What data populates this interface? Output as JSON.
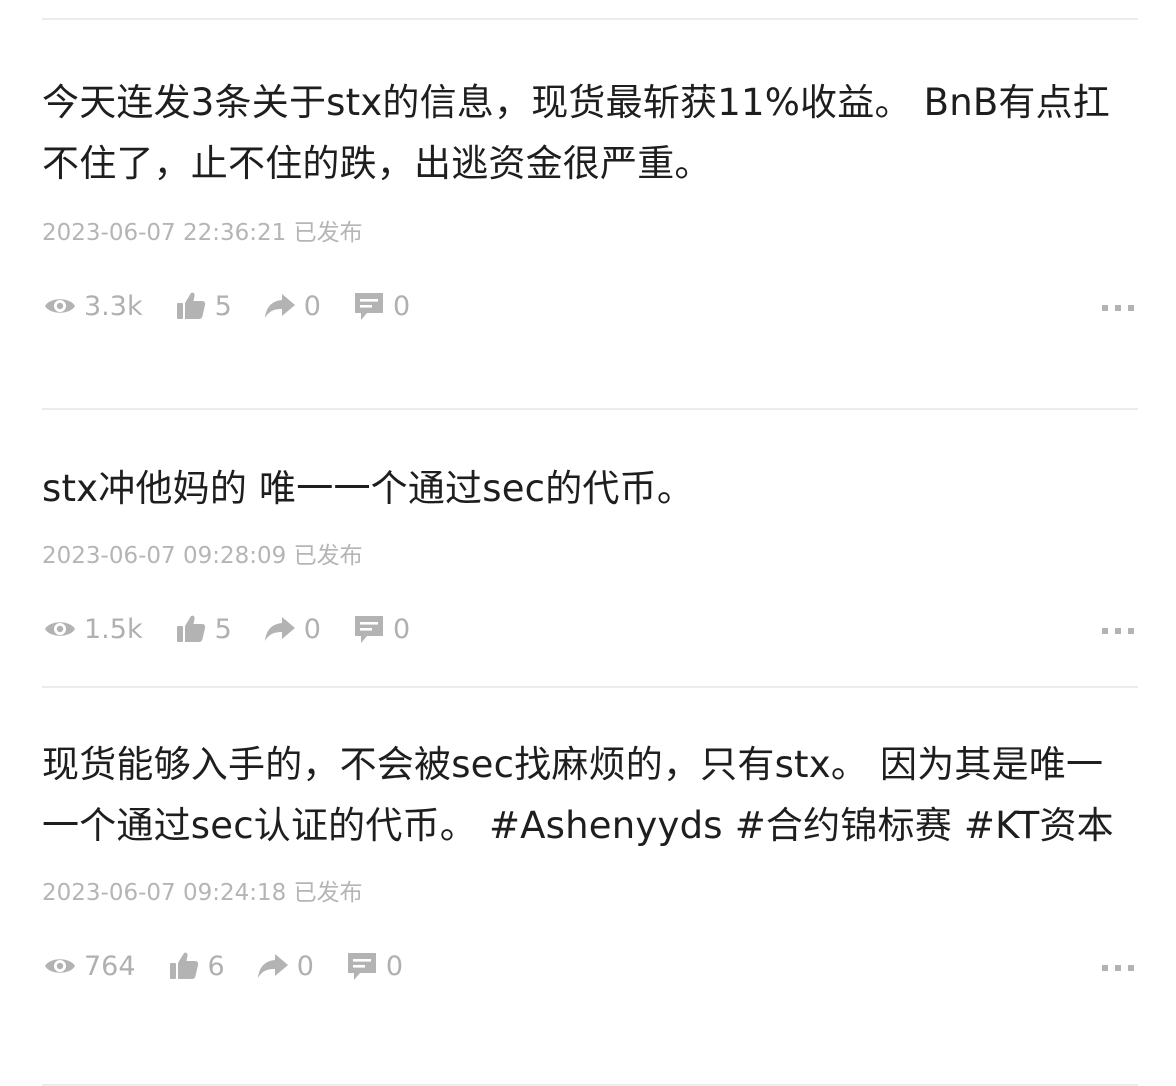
{
  "posts": [
    {
      "text": "今天连发3条关于stx的信息，现货最斩获11%收益。 BnB有点扛不住了，止不住的跌，出逃资金很严重。",
      "time": "2023-06-07 22:36:21 已发布",
      "views": "3.3k",
      "likes": "5",
      "shares": "0",
      "comments": "0"
    },
    {
      "text": "stx冲他妈的 唯一一个通过sec的代币。",
      "time": "2023-06-07 09:28:09 已发布",
      "views": "1.5k",
      "likes": "5",
      "shares": "0",
      "comments": "0"
    },
    {
      "text": "现货能够入手的，不会被sec找麻烦的，只有stx。 因为其是唯一一个通过sec认证的代币。 #Ashenyyds #合约锦标赛 #KT资本",
      "time": "2023-06-07 09:24:18 已发布",
      "views": "764",
      "likes": "6",
      "shares": "0",
      "comments": "0"
    }
  ],
  "icons": {
    "views": "eye-icon",
    "likes": "thumbs-up-icon",
    "shares": "share-arrow-icon",
    "comments": "comment-icon",
    "more": "more-dots-icon"
  },
  "colors": {
    "text": "#1e1e1e",
    "muted": "#b5b5b5",
    "icon": "#b3b3b3",
    "divider": "#ececec"
  }
}
